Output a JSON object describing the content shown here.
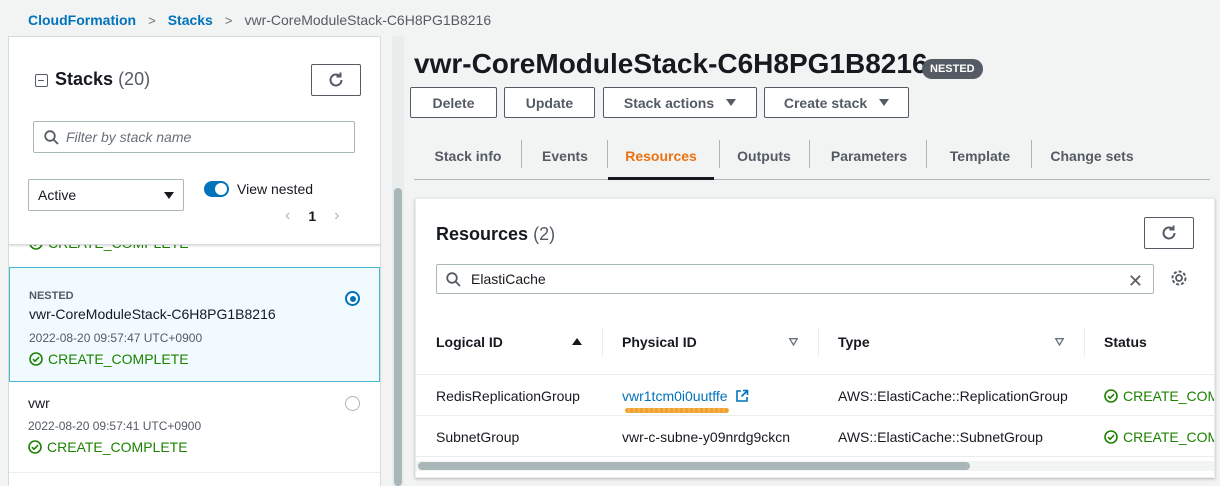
{
  "breadcrumb": {
    "root": "CloudFormation",
    "stacks": "Stacks",
    "current": "vwr-CoreModuleStack-C6H8PG1B8216"
  },
  "left_panel": {
    "title": "Stacks",
    "count": "(20)",
    "filter_placeholder": "Filter by stack name",
    "status_filter": "Active",
    "view_nested_label": "View nested",
    "view_nested_on": true,
    "page": "1",
    "partial_status": "CREATE_COMPLETE",
    "items": [
      {
        "tag": "NESTED",
        "name": "vwr-CoreModuleStack-C6H8PG1B8216",
        "date": "2022-08-20 09:57:47 UTC+0900",
        "status": "CREATE_COMPLETE",
        "selected": true
      },
      {
        "tag": "",
        "name": "vwr",
        "date": "2022-08-20 09:57:41 UTC+0900",
        "status": "CREATE_COMPLETE",
        "selected": false
      }
    ]
  },
  "stack": {
    "title": "vwr-CoreModuleStack-C6H8PG1B8216",
    "badge": "NESTED",
    "actions": {
      "delete": "Delete",
      "update": "Update",
      "stack_actions": "Stack actions",
      "create_stack": "Create stack"
    }
  },
  "tabs": [
    {
      "label": "Stack info"
    },
    {
      "label": "Events"
    },
    {
      "label": "Resources",
      "active": true
    },
    {
      "label": "Outputs"
    },
    {
      "label": "Parameters"
    },
    {
      "label": "Template"
    },
    {
      "label": "Change sets"
    }
  ],
  "resources": {
    "title": "Resources",
    "count": "(2)",
    "search_value": "ElastiCache",
    "columns": {
      "logical": "Logical ID",
      "physical": "Physical ID",
      "type": "Type",
      "status": "Status"
    },
    "rows": [
      {
        "logical": "RedisReplicationGroup",
        "physical": "vwr1tcm0i0uutffe",
        "type": "AWS::ElastiCache::ReplicationGroup",
        "status": "CREATE_COMPLETE"
      },
      {
        "logical": "SubnetGroup",
        "physical": "vwr-c-subne-y09nrdg9ckcn",
        "type": "AWS::ElastiCache::SubnetGroup",
        "status": "CREATE_COMPLETE"
      }
    ]
  },
  "colors": {
    "link": "#0073bb",
    "success": "#1d8102",
    "active_tab": "#ec7211",
    "text": "#16191f",
    "badge": "#545b64"
  }
}
